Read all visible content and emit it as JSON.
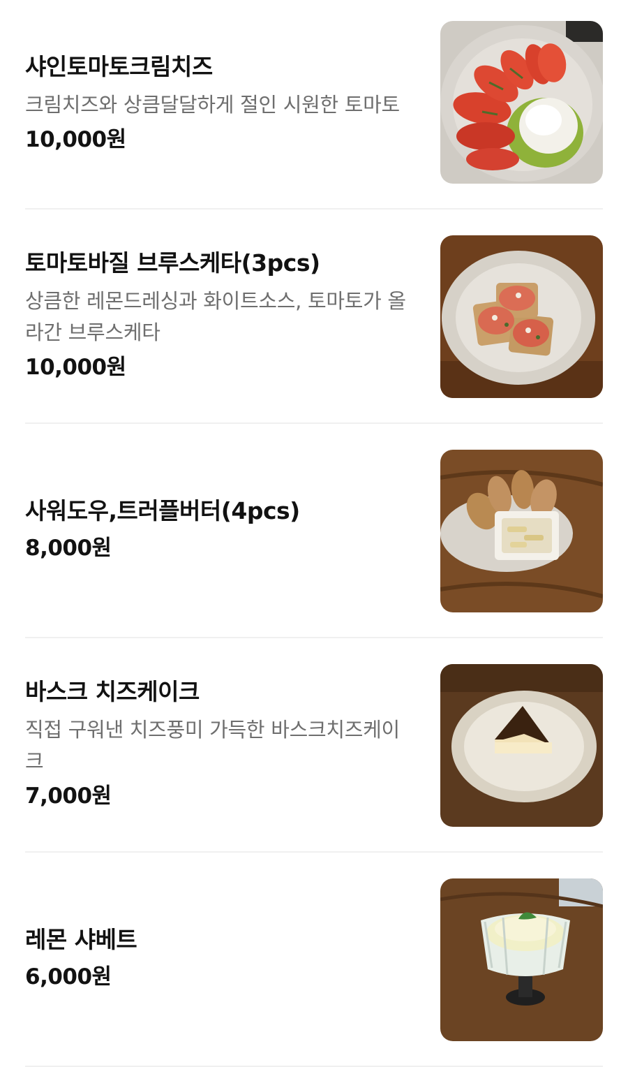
{
  "menu": {
    "items": [
      {
        "name": "샤인토마토크림치즈",
        "description": "크림치즈와 상큼달달하게 절인 시원한 토마토",
        "price": "10,000원",
        "photo_icon": "tomato-cream-cheese-photo"
      },
      {
        "name": "토마토바질 브루스케타(3pcs)",
        "description": "상큼한 레몬드레싱과 화이트소스, 토마토가 올라간 브루스케타",
        "price": "10,000원",
        "photo_icon": "bruschetta-photo"
      },
      {
        "name": "사워도우,트러플버터(4pcs)",
        "description": "",
        "price": "8,000원",
        "photo_icon": "sourdough-truffle-butter-photo"
      },
      {
        "name": "바스크 치즈케이크",
        "description": "직접 구워낸 치즈풍미 가득한 바스크치즈케이크",
        "price": "7,000원",
        "photo_icon": "basque-cheesecake-photo"
      },
      {
        "name": "레몬 샤베트",
        "description": "",
        "price": "6,000원",
        "photo_icon": "lemon-sherbet-photo"
      }
    ]
  },
  "colors": {
    "text_primary": "#121212",
    "text_secondary": "#6e6e6e",
    "divider": "#f0f0f0"
  }
}
